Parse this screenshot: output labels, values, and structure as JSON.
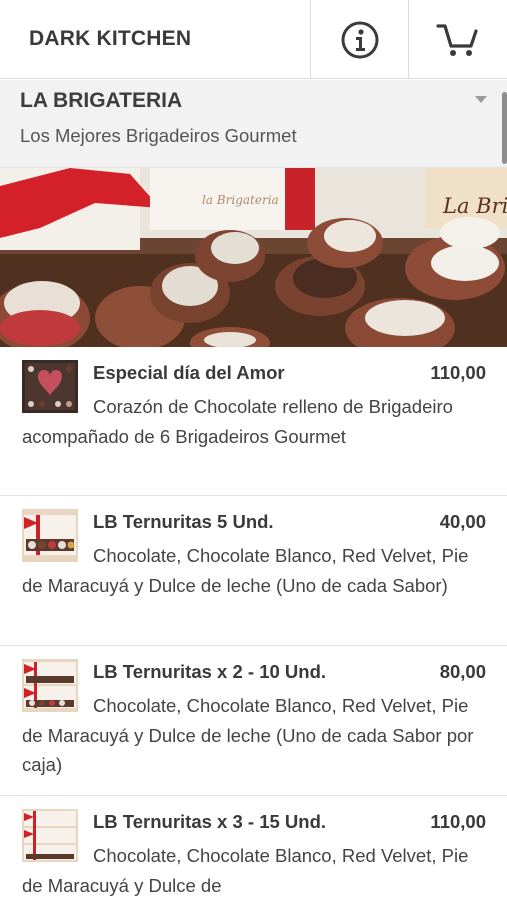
{
  "header": {
    "brand": "DARK KITCHEN",
    "info_icon": "info-circle-icon",
    "cart_icon": "shopping-cart-icon"
  },
  "store": {
    "name": "LA BRIGATERIA",
    "subtitle": "Los Mejores Brigadeiros Gourmet",
    "banner_logo": "La Brig"
  },
  "products": [
    {
      "title": "Especial día del Amor",
      "price": "110,00",
      "description": "Corazón de Chocolate relleno de Brigadeiro acompañado de 6 Brigadeiros Gourmet"
    },
    {
      "title": "LB Ternuritas 5 Und.",
      "price": "40,00",
      "description": "Chocolate, Chocolate Blanco, Red Velvet, Pie de Maracuyá y Dulce de leche (Uno de cada Sabor)"
    },
    {
      "title": "LB Ternuritas x 2 - 10 Und.",
      "price": "80,00",
      "description": "Chocolate, Chocolate Blanco, Red Velvet, Pie de Maracuyá y Dulce de leche (Uno de cada Sabor por caja)"
    },
    {
      "title": "LB Ternuritas x 3 - 15 Und.",
      "price": "110,00",
      "description": "Chocolate, Chocolate Blanco, Red Velvet, Pie de Maracuyá y Dulce de"
    }
  ]
}
